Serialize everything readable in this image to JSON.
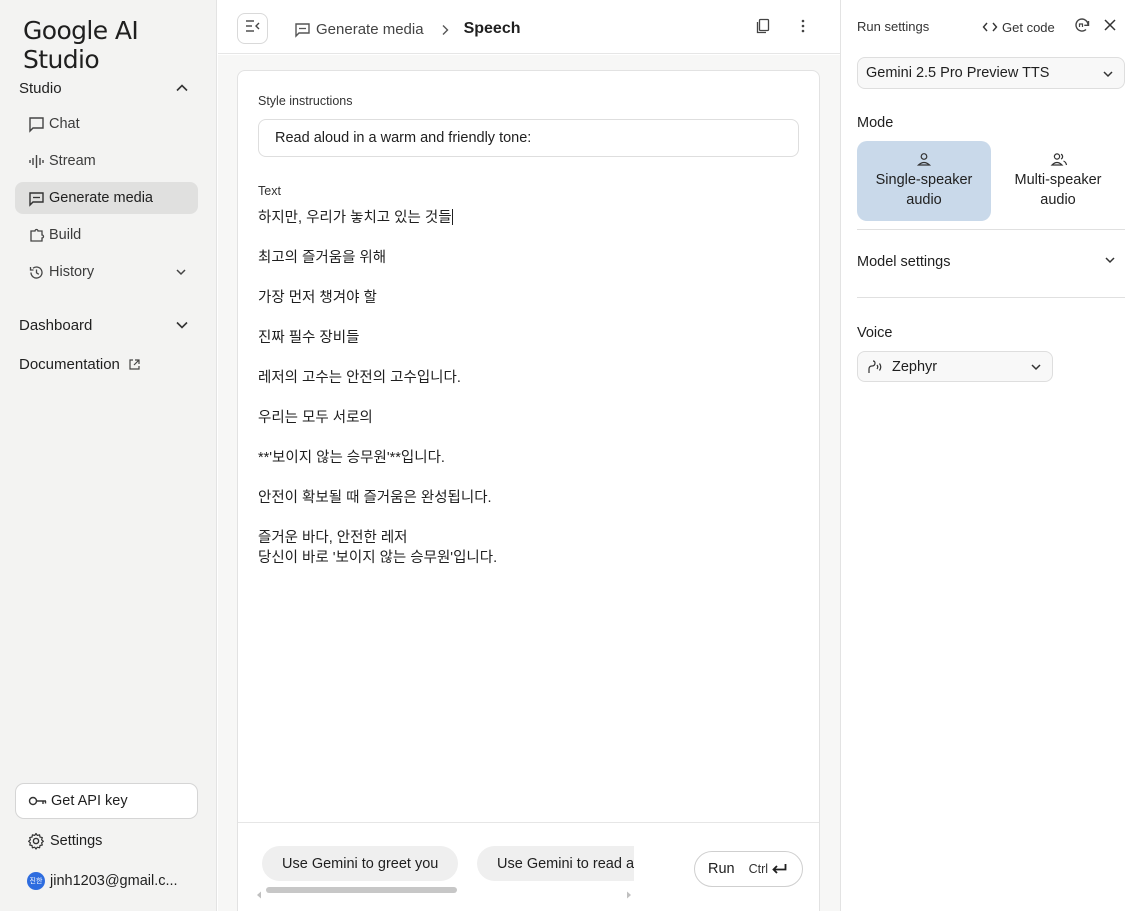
{
  "app": {
    "logo_text": "Google AI Studio"
  },
  "sidebar": {
    "studio_label": "Studio",
    "items": [
      {
        "label": "Chat",
        "icon": "chat-icon"
      },
      {
        "label": "Stream",
        "icon": "waveform-icon"
      },
      {
        "label": "Generate media",
        "icon": "media-icon",
        "active": true
      },
      {
        "label": "Build",
        "icon": "build-icon"
      },
      {
        "label": "History",
        "icon": "history-icon"
      }
    ],
    "dashboard_label": "Dashboard",
    "documentation_label": "Documentation",
    "api_key_label": "Get API key",
    "settings_label": "Settings",
    "account_email": "jinh1203@gmail.c...",
    "avatar_initials": "진한"
  },
  "header": {
    "breadcrumb_parent": "Generate media",
    "breadcrumb_current": "Speech"
  },
  "editor": {
    "style_label": "Style instructions",
    "style_value": "Read aloud in a warm and friendly tone:",
    "text_label": "Text",
    "text_lines": [
      "하지만, 우리가 놓치고 있는 것들",
      "",
      "최고의 즐거움을 위해",
      "",
      "가장 먼저 챙겨야 할",
      "",
      "진짜 필수 장비들",
      "",
      "레저의 고수는 안전의 고수입니다.",
      "",
      "우리는 모두 서로의",
      "",
      "**'보이지 않는 승무원'**입니다.",
      "",
      "안전이 확보될 때 즐거움은 완성됩니다.",
      "",
      "즐거운 바다, 안전한 레저",
      "당신이 바로 '보이지 않는 승무원'입니다."
    ]
  },
  "footer": {
    "chips": [
      "Use Gemini to greet you",
      "Use Gemini to read a"
    ],
    "run_label": "Run",
    "run_shortcut": "Ctrl"
  },
  "run_settings": {
    "title": "Run settings",
    "get_code_label": "Get code",
    "model": "Gemini 2.5 Pro Preview TTS",
    "mode_label": "Mode",
    "modes": [
      {
        "label": "Single-speaker audio",
        "line1": "Single-speaker",
        "line2": "audio",
        "active": true
      },
      {
        "label": "Multi-speaker audio",
        "line1": "Multi-speaker",
        "line2": "audio",
        "active": false
      }
    ],
    "model_settings_label": "Model settings",
    "voice_label": "Voice",
    "voice": "Zephyr"
  },
  "colors": {
    "sidebar_bg": "#f3f3f2",
    "active_nav": "#e0e0df",
    "mode_active": "#c9d9ea",
    "avatar": "#2d6cdf"
  }
}
